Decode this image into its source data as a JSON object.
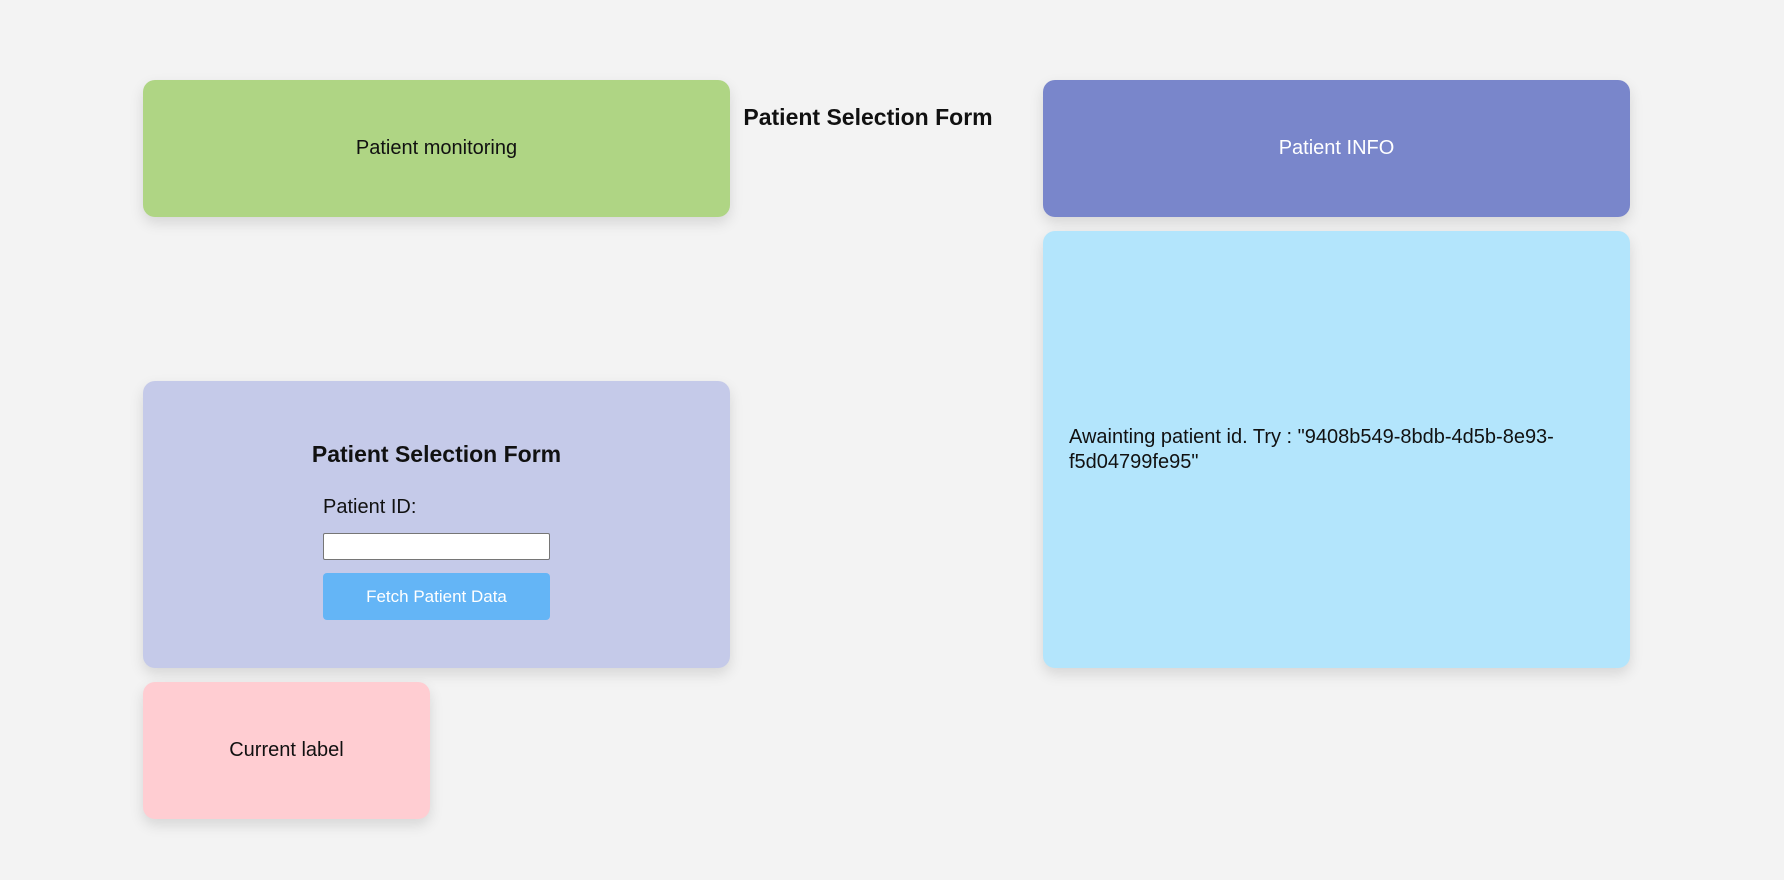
{
  "colors": {
    "background": "#f3f3f3",
    "monitor_card": "#afd584",
    "info_card": "#7986cb",
    "result_card": "#b3e5fc",
    "form_card": "#c5cae9",
    "label_card": "#ffcdd2",
    "fetch_button": "#64b5f6"
  },
  "monitor": {
    "title": "Patient monitoring"
  },
  "header": {
    "title": "Patient Selection Form"
  },
  "info": {
    "title": "Patient INFO",
    "message": "Awainting patient id. Try : \"9408b549-8bdb-4d5b-8e93-f5d04799fe95\""
  },
  "form": {
    "title": "Patient Selection Form",
    "patient_id_label": "Patient ID:",
    "patient_id_value": "",
    "patient_id_placeholder": "",
    "fetch_button_label": "Fetch Patient Data"
  },
  "label_card": {
    "text": "Current label"
  }
}
